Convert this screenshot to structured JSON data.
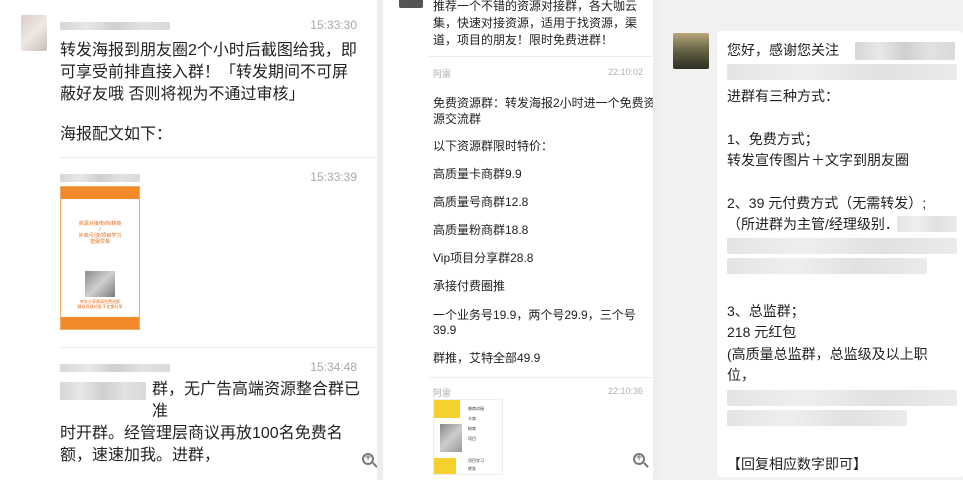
{
  "panel1": {
    "messages": [
      {
        "timestamp": "15:33:30",
        "text_lines": [
          "转发海报到朋友圈2个小时后截图给我，即",
          "可享受前排直接入群！「转发期间不可屏",
          "蔽好友哦 否则将视为不通过审核」",
          "",
          "海报配文如下："
        ]
      },
      {
        "timestamp": "15:33:39",
        "poster_lines": [
          "资源对接/粉商/转商",
          "/",
          "外商/引流/项目学习",
          "担保交易"
        ],
        "poster_footer": [
          "转发分享邀请免费进群",
          "精准资源对接 不定期分享"
        ]
      },
      {
        "timestamp": "15:34:48",
        "text_lines": [
          "群，无广告高端资源整合群已准",
          "时开群。经管理层商议再放100名免费名",
          "额，速速加我。进群，"
        ]
      }
    ]
  },
  "panel2": {
    "intro_lines": [
      "推荐一个不错的资源对接群，各大咖云",
      "集，快速对接资源，适用于找资源，渠",
      "道，项目的朋友！限时免费进群！"
    ],
    "sender1": "阿雷",
    "time1": "22:10:02",
    "content_lines": [
      "免费资源群：转发海报2小时进一个免费资",
      "源交流群",
      "以下资源群限时特价：",
      "高质量卡商群9.9",
      "高质量号商群12.8",
      "高质量粉商群18.8",
      "Vip项目分享群28.8",
      "承接付费圈推",
      "一个业务号19.9，两个号29.9，三个号",
      "39.9",
      "群推，艾特全部49.9"
    ],
    "sender2": "阿雷",
    "time2": "22:10:36",
    "thumb_words": [
      "做商对接",
      "卡商",
      "粉商",
      "项目",
      "项目学习",
      "转发"
    ]
  },
  "panel3": {
    "lines": [
      "您好，感谢您关注",
      "进群有三种方式：",
      "1、免费方式；",
      "转发宣传图片＋文字到朋友圈",
      "2、39 元付费方式（无需转发）;",
      "（所进群为主管/经理级别．",
      "3、总监群；",
      "218 元红包",
      "(高质量总监群，总监级及以上职",
      "位，",
      "【回复相应数字即可】"
    ]
  }
}
